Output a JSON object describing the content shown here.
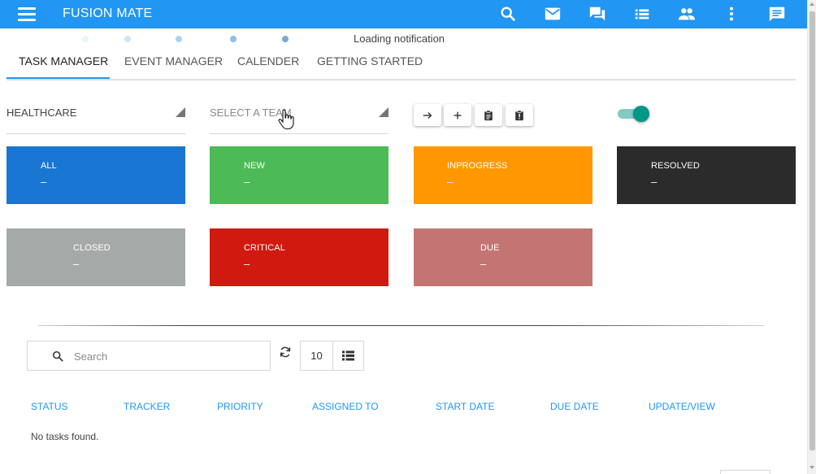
{
  "app": {
    "title": "FUSION MATE"
  },
  "appbar_actions": [
    {
      "icon": "search-icon"
    },
    {
      "icon": "mail-icon"
    },
    {
      "icon": "forum-icon"
    },
    {
      "icon": "list-icon"
    },
    {
      "icon": "people-icon"
    },
    {
      "icon": "more-vert-icon"
    },
    {
      "icon": "chat-icon"
    }
  ],
  "loading": {
    "text": "Loading notification",
    "dot_colors": [
      "#e6f4fb",
      "#cbe6f6",
      "#a9d4f0",
      "#8cc0e6",
      "#7aa9d6"
    ]
  },
  "tabs": [
    {
      "label": "TASK MANAGER",
      "active": true
    },
    {
      "label": "EVENT MANAGER",
      "active": false
    },
    {
      "label": "CALENDER",
      "active": false
    },
    {
      "label": "GETTING STARTED",
      "active": false
    }
  ],
  "filters": {
    "department": "HEALTHCARE",
    "team_placeholder": "SELECT A TEAM"
  },
  "action_buttons": [
    {
      "icon": "arrow-right-icon"
    },
    {
      "icon": "add-icon"
    },
    {
      "icon": "clipboard-icon"
    },
    {
      "icon": "clipboard-alert-icon"
    }
  ],
  "toggle": {
    "on": true,
    "color": "#009688"
  },
  "status_cards": [
    {
      "label": "ALL",
      "count": "–",
      "color": "#1976d2"
    },
    {
      "label": "NEW",
      "count": "–",
      "color": "#4cbb57"
    },
    {
      "label": "INPROGRESS",
      "count": "–",
      "color": "#ff9800"
    },
    {
      "label": "RESOLVED",
      "count": "–",
      "color": "#2b2b2b"
    },
    {
      "label": "CLOSED",
      "count": "–",
      "color": "#a5aaa8"
    },
    {
      "label": "CRITICAL",
      "count": "–",
      "color": "#d0190f"
    },
    {
      "label": "DUE",
      "count": "–",
      "color": "#c37473"
    }
  ],
  "search": {
    "placeholder": "Search",
    "value": ""
  },
  "page_size": "10",
  "table": {
    "columns": [
      "STATUS",
      "TRACKER",
      "PRIORITY",
      "ASSIGNED TO",
      "START DATE",
      "DUE DATE",
      "UPDATE/VIEW"
    ],
    "empty_message": "No tasks found."
  }
}
